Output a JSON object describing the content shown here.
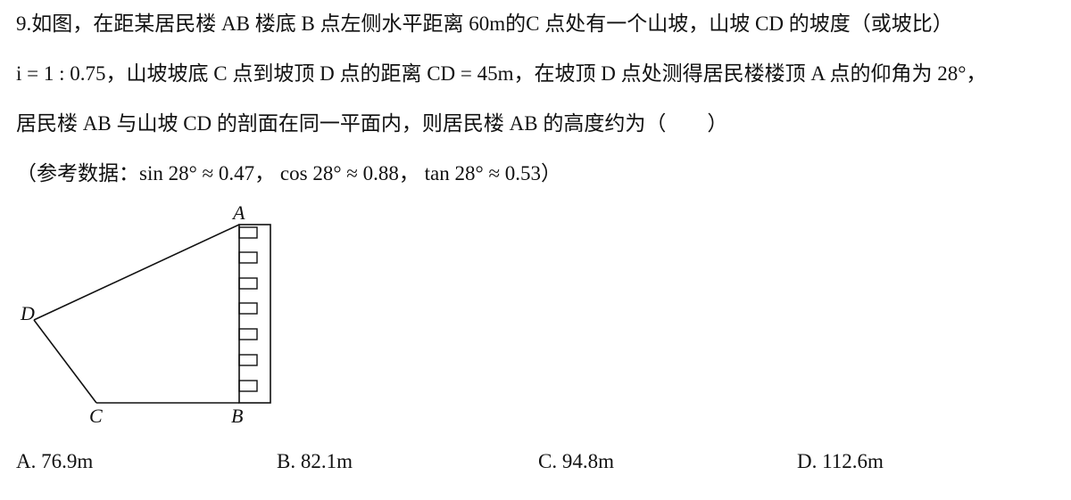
{
  "question": {
    "line1": "9.如图，在距某居民楼 AB 楼底 B 点左侧水平距离 60m的C 点处有一个山坡，山坡 CD 的坡度（或坡比）",
    "line2": "i = 1 : 0.75，山坡坡底 C 点到坡顶 D 点的距离 CD = 45m，在坡顶 D 点处测得居民楼楼顶 A 点的仰角为 28°，",
    "line3": "居民楼 AB 与山坡 CD 的剖面在同一平面内，则居民楼 AB 的高度约为（　　）",
    "line4": "（参考数据：sin 28° ≈ 0.47， cos 28° ≈ 0.88， tan 28° ≈ 0.53）"
  },
  "figure": {
    "label_a": "A",
    "label_b": "B",
    "label_c": "C",
    "label_d": "D"
  },
  "options": {
    "a": "A. 76.9m",
    "b": "B. 82.1m",
    "c": "C. 94.8m",
    "d": "D. 112.6m"
  }
}
